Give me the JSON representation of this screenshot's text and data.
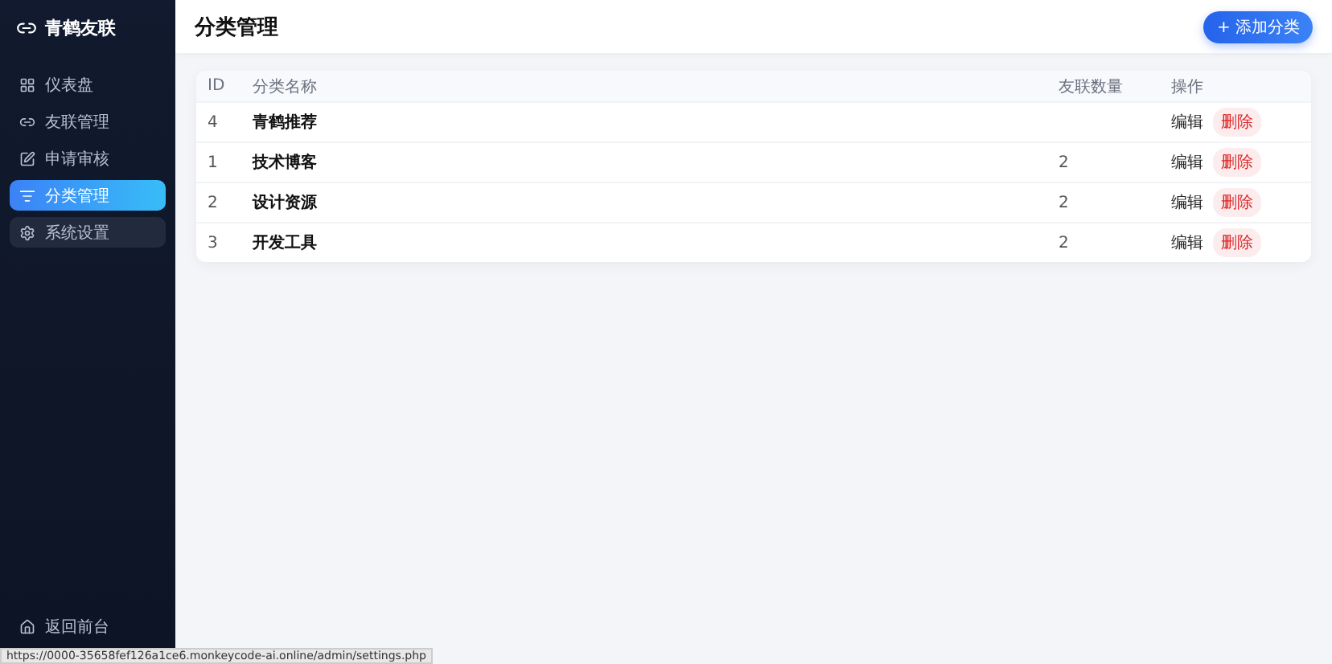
{
  "sidebar": {
    "brand": "青鹤友联",
    "items": [
      {
        "label": "仪表盘",
        "selected": false,
        "hovered": false
      },
      {
        "label": "友联管理",
        "selected": false,
        "hovered": false
      },
      {
        "label": "申请审核",
        "selected": false,
        "hovered": false
      },
      {
        "label": "分类管理",
        "selected": true,
        "hovered": false
      },
      {
        "label": "系统设置",
        "selected": false,
        "hovered": true
      }
    ],
    "footer": "返回前台"
  },
  "header": {
    "title": "分类管理",
    "add_button": "+ 添加分类"
  },
  "table": {
    "columns": [
      "ID",
      "分类名称",
      "友联数量",
      "操作"
    ],
    "rows": [
      {
        "id": "4",
        "name": "青鹤推荐",
        "edit": "编辑",
        "delete": "删除"
      },
      {
        "id": "1",
        "name": "技术博客",
        "count": "2",
        "edit": "编辑",
        "delete": "删除"
      },
      {
        "id": "2",
        "name": "设计资源",
        "count": "2",
        "edit": "编辑",
        "delete": "删除"
      },
      {
        "id": "3",
        "name": "开发工具",
        "count": "2",
        "edit": "编辑",
        "delete": "删除"
      }
    ]
  },
  "status_bar": "https://0000-35658fef126a1ce6.monkeycode-ai.online/admin/settings.php"
}
